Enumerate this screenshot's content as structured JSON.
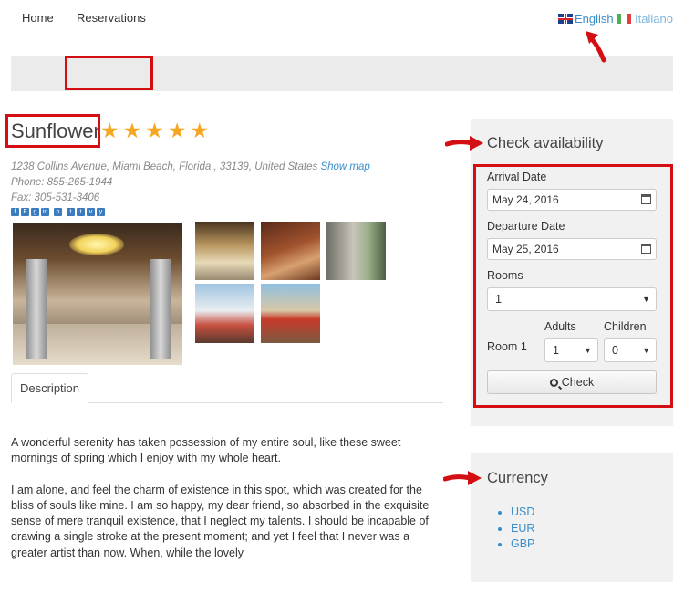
{
  "languages": [
    {
      "label": "English",
      "active": true,
      "flag": "uk-flag-icon"
    },
    {
      "label": "Italiano",
      "active": false,
      "flag": "italy-flag-icon",
      "flag_colors": [
        "#4caf50",
        "#ffffff",
        "#e04040"
      ]
    }
  ],
  "nav": {
    "home": "Home",
    "reservations": "Reservations"
  },
  "hotel": {
    "name": "Sunflower",
    "stars": 5,
    "address": "1238 Collins Avenue, Miami Beach, Florida , 33139, United States",
    "show_map": "Show map",
    "phone": "Phone: 855-265-1944",
    "fax": "Fax: 305-531-3406"
  },
  "tabs": {
    "description": "Description"
  },
  "description": [
    "A wonderful serenity has taken possession of my entire soul, like these sweet mornings of spring which I enjoy with my whole heart.",
    "I am alone, and feel the charm of existence in this spot, which was created for the bliss of souls like mine. I am so happy, my dear friend, so absorbed in the exquisite sense of mere tranquil existence, that I neglect my talents. I should be incapable of drawing a single stroke at the present moment; and yet I feel that I never was a greater artist than now. When, while the lovely"
  ],
  "availability": {
    "title": "Check availability",
    "arrival_label": "Arrival Date",
    "arrival_value": "May 24, 2016",
    "departure_label": "Departure Date",
    "departure_value": "May 25, 2016",
    "rooms_label": "Rooms",
    "rooms_value": "1",
    "adults_label": "Adults",
    "children_label": "Children",
    "room_label": "Room 1",
    "adults_value": "1",
    "children_value": "0",
    "check_label": "Check"
  },
  "currency": {
    "title": "Currency",
    "items": [
      "USD",
      "EUR",
      "GBP"
    ]
  },
  "colors": {
    "accent": "#3a8dc9",
    "star": "#f5a623",
    "annotation": "#d40f14"
  }
}
